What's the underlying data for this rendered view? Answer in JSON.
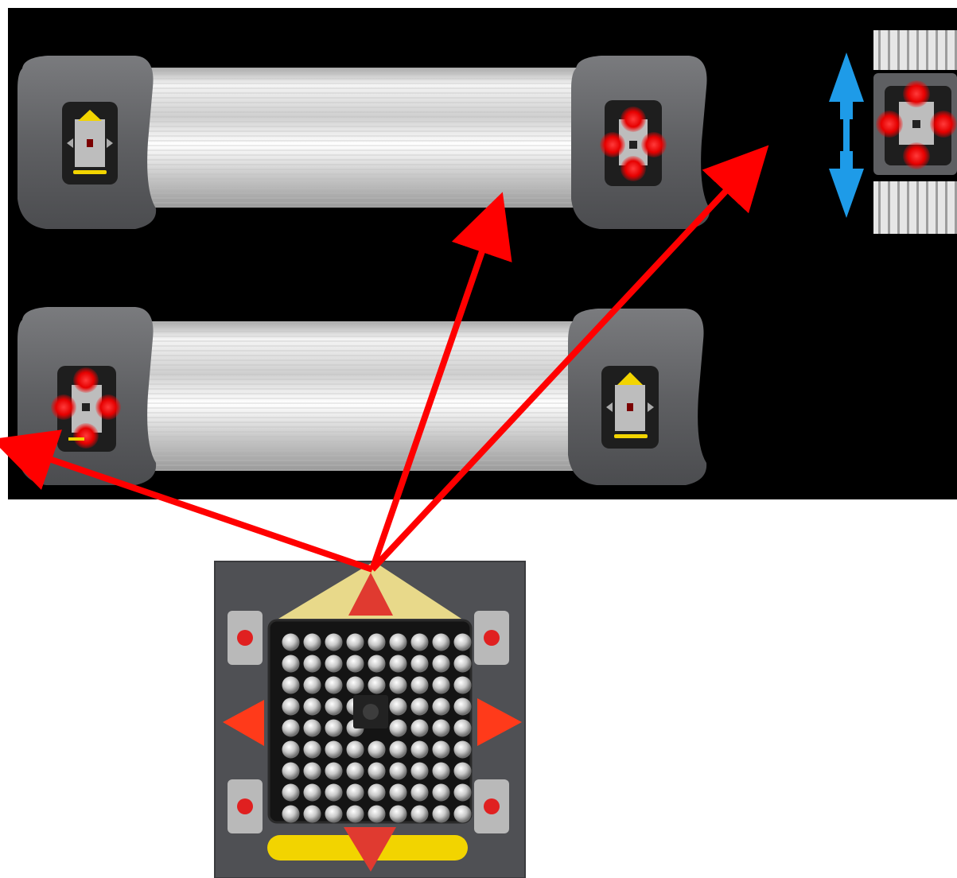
{
  "diagram": {
    "background_panel_color": "#000000",
    "page_background_color": "#ffffff",
    "rail_color": "#d9d9d9",
    "head_color": "#6a6b6e",
    "led_color": "#d8d8d8",
    "led_active_color": "#ff1a1a",
    "arrow_color": "#ff0000",
    "indicator_yellow": "#f2d400",
    "vertical_arrow_color": "#1e9be8",
    "units": [
      {
        "id": "top-bar",
        "left_head_state": "idle",
        "right_head_state": "active"
      },
      {
        "id": "bottom-bar",
        "left_head_state": "active",
        "right_head_state": "idle"
      },
      {
        "id": "side-view",
        "head_state": "active",
        "motion": "vertical"
      }
    ],
    "detail_panel": {
      "subject": "sensor-head-closeup",
      "led_grid_rows": 9,
      "led_grid_cols": 9,
      "active_arrows": [
        "up",
        "down",
        "left",
        "right"
      ],
      "indicators": [
        "top-left",
        "top-right",
        "bottom-left",
        "bottom-right"
      ]
    },
    "callouts": [
      {
        "from": "detail_panel",
        "to": "bottom-bar-left-head"
      },
      {
        "from": "detail_panel",
        "to": "top-bar-rail"
      },
      {
        "from": "detail_panel",
        "to": "side-view"
      }
    ]
  }
}
